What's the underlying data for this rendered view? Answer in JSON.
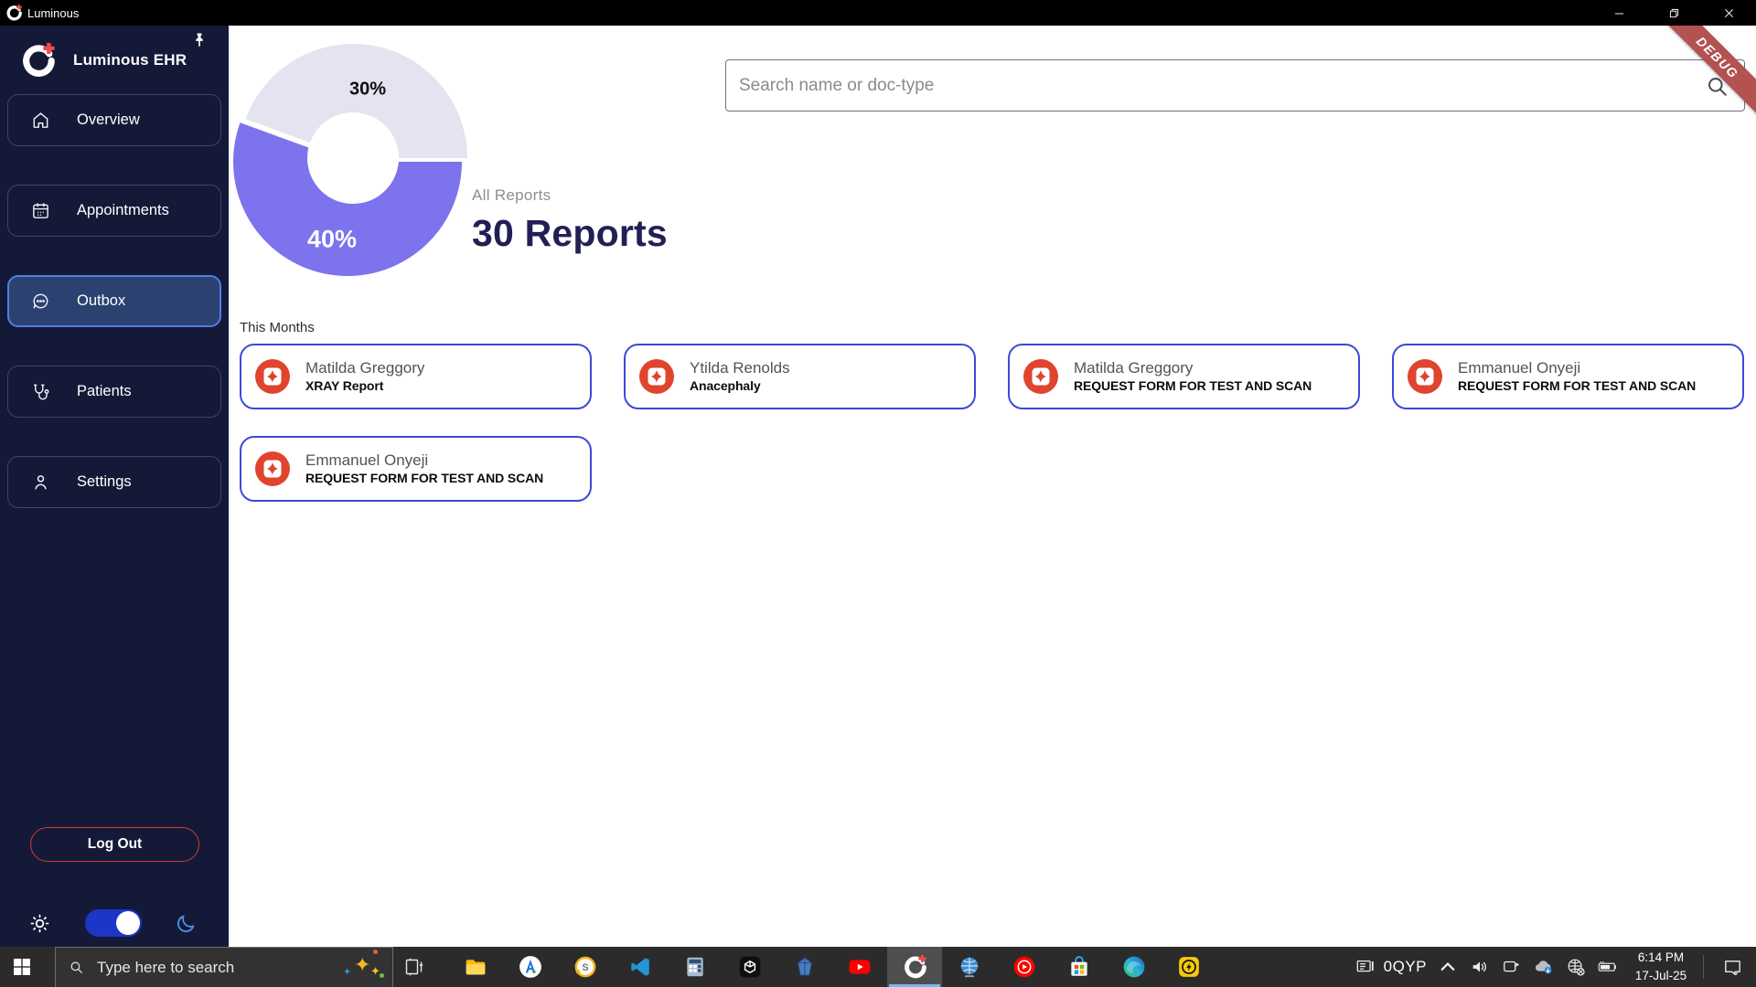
{
  "window": {
    "app_title": "Luminous",
    "controls": {
      "minimize": "minimize",
      "maximize": "maximize",
      "close": "close"
    }
  },
  "debug_ribbon": {
    "label": "DEBUG",
    "color": "#b45151"
  },
  "colors": {
    "sidebar_bg": "#141938",
    "sidebar_active_bg": "#2b4271",
    "sidebar_active_border": "#4f80e2",
    "chart_purple": "#7d73ec",
    "chart_gray": "#e4e4f1",
    "heading_navy": "#221f55",
    "card_border": "#3c49d9",
    "pdf_red": "#e0442f",
    "logout_border": "#cf3c33",
    "toggle_blue": "#1c36c8",
    "taskbar_bg": "#2b2b2b",
    "active_app_underline": "#76b9ed"
  },
  "sidebar": {
    "brand": "Luminous EHR",
    "brand_logo_icon": "luminous-logo-icon",
    "pin_icon": "pin-icon",
    "items": [
      {
        "label": "Overview",
        "icon": "home-icon",
        "active": false
      },
      {
        "label": "Appointments",
        "icon": "calendar-icon",
        "active": false
      },
      {
        "label": "Outbox",
        "icon": "chat-bubble-icon",
        "active": true
      },
      {
        "label": "Patients",
        "icon": "stethoscope-icon",
        "active": false
      },
      {
        "label": "Settings",
        "icon": "person-icon",
        "active": false
      }
    ],
    "logout_label": "Log Out",
    "theme_toggle": {
      "state": "on",
      "left_icon": "sun-icon",
      "right_icon": "moon-icon"
    }
  },
  "main": {
    "search": {
      "placeholder": "Search name or doc-type",
      "icon": "search-icon",
      "value": ""
    },
    "summary": {
      "label": "All Reports",
      "value": "30 Reports"
    },
    "section_title": "This Months",
    "cards": [
      {
        "name": "Matilda Greggory",
        "doc_type": "XRAY Report"
      },
      {
        "name": "Ytilda Renolds",
        "doc_type": "Anacephaly"
      },
      {
        "name": "Matilda Greggory",
        "doc_type": "REQUEST FORM FOR TEST AND SCAN"
      },
      {
        "name": "Emmanuel Onyeji",
        "doc_type": "REQUEST FORM FOR TEST AND SCAN"
      },
      {
        "name": "Emmanuel Onyeji",
        "doc_type": "REQUEST FORM FOR TEST AND SCAN"
      }
    ]
  },
  "chart_data": {
    "type": "pie",
    "title": "All Reports donut",
    "donut": true,
    "slices": [
      {
        "label": "40%",
        "value": 40,
        "color": "#7d73ec"
      },
      {
        "label": "30%",
        "value": 30,
        "color": "#e4e4f1"
      }
    ],
    "legend_position": "none"
  },
  "taskbar": {
    "start_icon": "windows-start-icon",
    "search_placeholder": "Type here to search",
    "search_icon": "search-icon",
    "copilot_icon": "sparkles-icon",
    "taskview_icon": "task-view-icon",
    "apps": [
      "file-explorer-icon",
      "designer-app-icon",
      "coin-clock-icon",
      "vscode-icon",
      "calculator-icon",
      "unity-icon",
      "spaceship-icon",
      "youtube-icon",
      "luminous-logo-icon",
      "internet-globe-icon",
      "youtube-music-icon",
      "microsoft-store-icon",
      "edge-icon",
      "power-app-icon"
    ],
    "active_app_icon": "luminous-logo-icon",
    "tray": {
      "ime_icon": "keyboard-ime-icon",
      "ime_label": "0QYP",
      "icons": [
        "chevron-up-icon",
        "volume-icon",
        "screen-cast-icon",
        "onedrive-sync-icon",
        "no-internet-icon",
        "battery-charging-icon"
      ],
      "time": "6:14 PM",
      "date": "17-Jul-25",
      "notification_icon": "notification-icon"
    }
  }
}
